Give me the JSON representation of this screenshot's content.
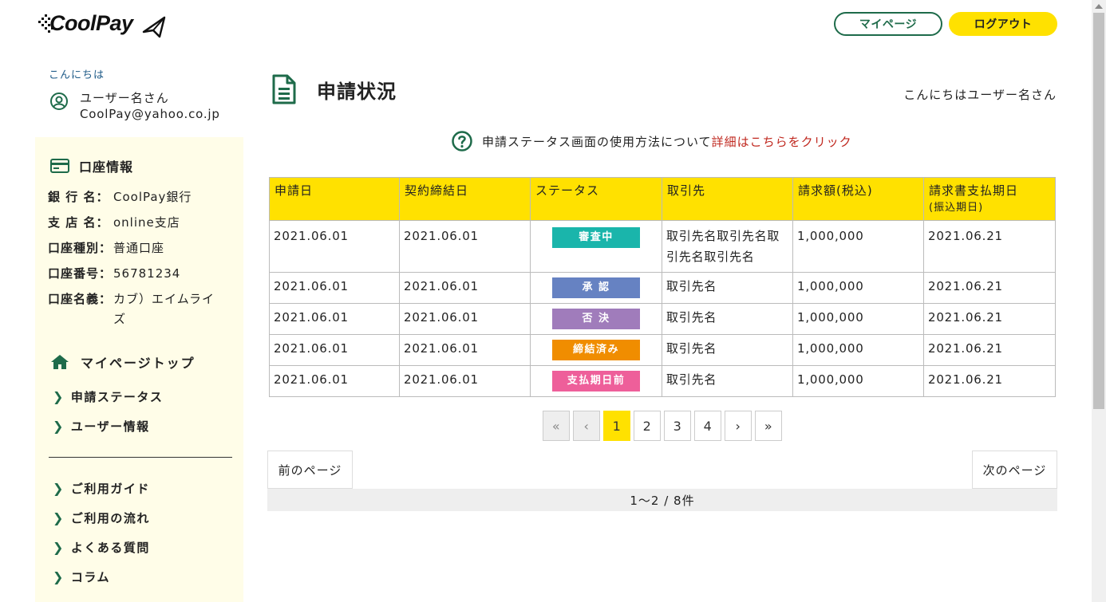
{
  "header": {
    "logo_text": "CoolPay",
    "mypage_label": "マイページ",
    "logout_label": "ログアウト"
  },
  "user": {
    "greeting": "こんにちは",
    "name": "ユーザー名さん",
    "email": "CoolPay@yahoo.co.jp"
  },
  "account": {
    "title": "口座情報",
    "bank_label": "銀 行 名：",
    "bank_value": "CoolPay銀行",
    "branch_label": "支 店 名：",
    "branch_value": "online支店",
    "type_label": "口座種別：",
    "type_value": "普通口座",
    "number_label": "口座番号：",
    "number_value": "56781234",
    "holder_label": "口座名義：",
    "holder_value_1": "カブ）エイムライ",
    "holder_value_2": "ズ"
  },
  "nav": {
    "home": "マイページトップ",
    "items_top": [
      "申請ステータス",
      "ユーザー情報"
    ],
    "items_bottom": [
      "ご利用ガイド",
      "ご利用の流れ",
      "よくある質問",
      "コラム"
    ]
  },
  "main": {
    "title": "申請状況",
    "hello": "こんにちはユーザー名さん",
    "help_text": "申請ステータス画面の使用方法について",
    "help_link": "詳細はこちらをクリック"
  },
  "table": {
    "headers": [
      "申請日",
      "契約締結日",
      "ステータス",
      "取引先",
      "請求額(税込)",
      "請求書支払期日"
    ],
    "header_sub": "(振込期日)",
    "rows": [
      {
        "apply": "2021.06.01",
        "contract": "2021.06.01",
        "status": "審査中",
        "partner": "取引先名取引先名取引先名取引先名",
        "amount": "1,000,000",
        "due": "2021.06.21"
      },
      {
        "apply": "2021.06.01",
        "contract": "2021.06.01",
        "status": "承 認",
        "partner": "取引先名",
        "amount": "1,000,000",
        "due": "2021.06.21"
      },
      {
        "apply": "2021.06.01",
        "contract": "2021.06.01",
        "status": "否 決",
        "partner": "取引先名",
        "amount": "1,000,000",
        "due": "2021.06.21"
      },
      {
        "apply": "2021.06.01",
        "contract": "2021.06.01",
        "status": "締結済み",
        "partner": "取引先名",
        "amount": "1,000,000",
        "due": "2021.06.21"
      },
      {
        "apply": "2021.06.01",
        "contract": "2021.06.01",
        "status": "支払期日前",
        "partner": "取引先名",
        "amount": "1,000,000",
        "due": "2021.06.21"
      }
    ],
    "status_colors": {
      "審査中": "#1ab5ab",
      "承 認": "#6682c2",
      "否 決": "#a07cbb",
      "締結済み": "#f08d00",
      "支払期日前": "#ee5f9a"
    }
  },
  "pagination": {
    "first": "«",
    "prev": "‹",
    "pages": [
      "1",
      "2",
      "3",
      "4"
    ],
    "next": "›",
    "last": "»",
    "current": "1"
  },
  "footer": {
    "prev_label": "前のページ",
    "next_label": "次のページ",
    "count": "1〜2 / 8件"
  },
  "colors": {
    "brand_green": "#1e6b4a",
    "accent_yellow": "#ffe100",
    "sidebar_bg": "#fffde8",
    "link_red": "#c0281f"
  }
}
